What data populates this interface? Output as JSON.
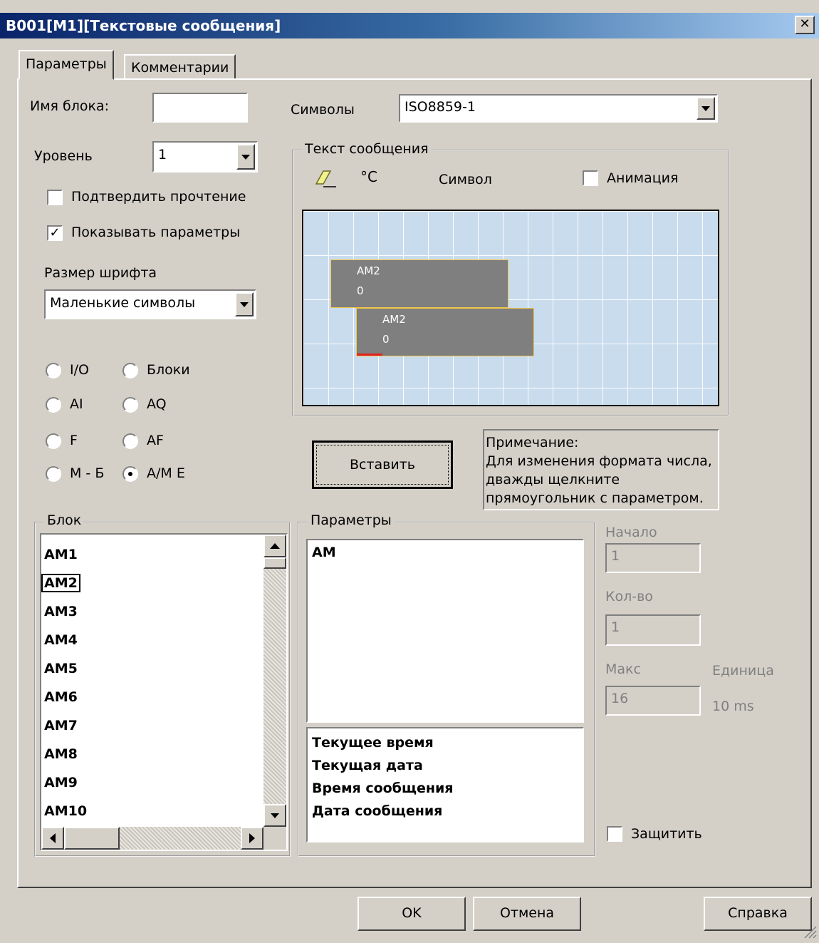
{
  "window": {
    "title": "B001[M1][Текстовые сообщения]",
    "close_symbol": "✕"
  },
  "tabs": [
    {
      "label": "Параметры"
    },
    {
      "label": "Комментарии"
    }
  ],
  "block_name": {
    "label": "Имя блока:",
    "value": ""
  },
  "charset": {
    "label": "Символы",
    "value": "ISO8859-1"
  },
  "level": {
    "label": "Уровень",
    "value": "1"
  },
  "confirm_read": {
    "label": "Подтвердить прочтение",
    "checked": false
  },
  "show_params": {
    "label": "Показывать параметры",
    "checked": true
  },
  "font_size": {
    "label": "Размер шрифта",
    "value": "Маленькие символы"
  },
  "radios": [
    {
      "label": "I/O",
      "selected": false
    },
    {
      "label": "Блоки",
      "selected": false
    },
    {
      "label": "AI",
      "selected": false
    },
    {
      "label": "AQ",
      "selected": false
    },
    {
      "label": "F",
      "selected": false
    },
    {
      "label": "AF",
      "selected": false
    },
    {
      "label": "M - Б",
      "selected": false
    },
    {
      "label": "A/M E",
      "selected": true
    }
  ],
  "message_text": {
    "legend": "Текст сообщения",
    "degree_symbol": "°C",
    "symbol_label": "Символ",
    "animation_label": "Анимация",
    "animation_checked": false,
    "boxes": [
      {
        "name": "AM2",
        "value": "0"
      },
      {
        "name": "AM2",
        "value": "0"
      }
    ]
  },
  "insert_button": "Вставить",
  "note": {
    "line1": "Примечание:",
    "line2": "Для изменения формата числа,",
    "line3": "дважды щелкните",
    "line4": "прямоугольник с параметром."
  },
  "block_list": {
    "legend": "Блок",
    "items": [
      "AM1",
      "AM2",
      "AM3",
      "AM4",
      "AM5",
      "AM6",
      "AM7",
      "AM8",
      "AM9",
      "AM10"
    ]
  },
  "params_group": {
    "legend": "Параметры",
    "upper_items": [
      "AM"
    ],
    "lower_items": [
      "Текущее время",
      "Текущая дата",
      "Время сообщения",
      "Дата сообщения"
    ]
  },
  "right_fields": {
    "start_label": "Начало",
    "start_value": "1",
    "count_label": "Кол-во",
    "count_value": "1",
    "max_label": "Макс",
    "max_value": "16",
    "unit_label": "Единица",
    "unit_value": "10 ms"
  },
  "protect": {
    "label": "Защитить",
    "checked": false
  },
  "buttons": {
    "ok": "OK",
    "cancel": "Отмена",
    "help": "Справка"
  }
}
